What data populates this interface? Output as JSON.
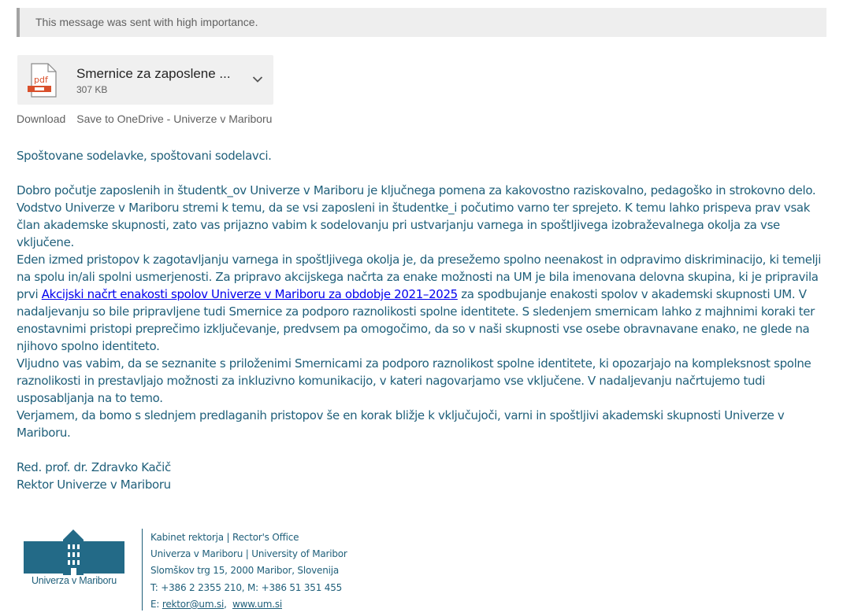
{
  "importance_banner": "This message was sent with high importance.",
  "attachment": {
    "icon": "pdf-file-icon",
    "icon_label": "pdf",
    "name": "Smernice za zaposlene ...",
    "size": "307 KB",
    "actions": {
      "download": "Download",
      "save": "Save to OneDrive - Univerze v Mariboru"
    }
  },
  "message": {
    "greeting": "Spoštovane sodelavke, spoštovani sodelavci.",
    "p1": "Dobro počutje zaposlenih in študentk_ov Univerze v Mariboru je ključnega pomena za kakovostno raziskovalno, pedagoško in strokovno delo. Vodstvo Univerze v Mariboru stremi k temu, da se vsi zaposleni in študentke_i počutimo varno ter sprejeto. K temu lahko prispeva prav vsak član akademske skupnosti, zato vas prijazno vabim k sodelovanju pri ustvarjanju varnega in spoštljivega izobraževalnega okolja za vse vključene.",
    "p2_before": "Eden izmed pristopov k zagotavljanju varnega in spoštljivega okolja je, da presežemo spolno neenakost in odpravimo diskriminacijo, ki temelji na spolu in/ali spolni usmerjenosti. Za pripravo akcijskega načrta za enake možnosti na UM je bila imenovana delovna skupina, ki je pripravila prvi ",
    "p2_link": "Akcijski načrt enakosti spolov Univerze v Mariboru za obdobje 2021–2025",
    "p2_after": " za spodbujanje enakosti spolov v akademski skupnosti UM. V nadaljevanju so bile pripravljene tudi Smernice za podporo raznolikosti spolne identitete. S sledenjem smernicam lahko z majhnimi koraki ter enostavnimi pristopi preprečimo izključevanje, predvsem pa omogočimo, da so v naši skupnosti vse osebe obravnavane enako, ne glede na njihovo spolno identiteto.",
    "p3": "Vljudno vas vabim, da se seznanite s priloženimi Smernicami za podporo raznolikost spolne identitete, ki opozarjajo na kompleksnost spolne raznolikosti in prestavljajo možnosti za inkluzivno komunikacijo, v kateri nagovarjamo vse vključene. V nadaljevanju načrtujemo tudi usposabljanja na to temo.",
    "p4": "Verjamem, da bomo s slednjem predlaganih pristopov še en korak bližje k vključujoči, varni in spoštljivi akademski skupnosti Univerze v Mariboru.",
    "sign_name": "Red. prof. dr. Zdravko Kačič",
    "sign_title": "Rektor Univerze v Mariboru"
  },
  "signature": {
    "logo_icon": "university-building-logo-icon",
    "logo_text": "Univerza v Mariboru",
    "office": "Kabinet rektorja | Rector's Office",
    "university": "Univerza v Mariboru | University of Maribor",
    "address": "Slomškov trg 15, 2000 Maribor, Slovenija",
    "phones": "T: +386 2 2355 210, M: +386 51 351 455",
    "email_prefix": "E: ",
    "email": "rektor@um.si",
    "web": "www.um.si"
  },
  "colors": {
    "body_text": "#1f5f7a",
    "link": "#0000ee",
    "banner_bg": "#eeeeee",
    "banner_border": "#a3a3a3",
    "pdf_red": "#d9502c"
  }
}
